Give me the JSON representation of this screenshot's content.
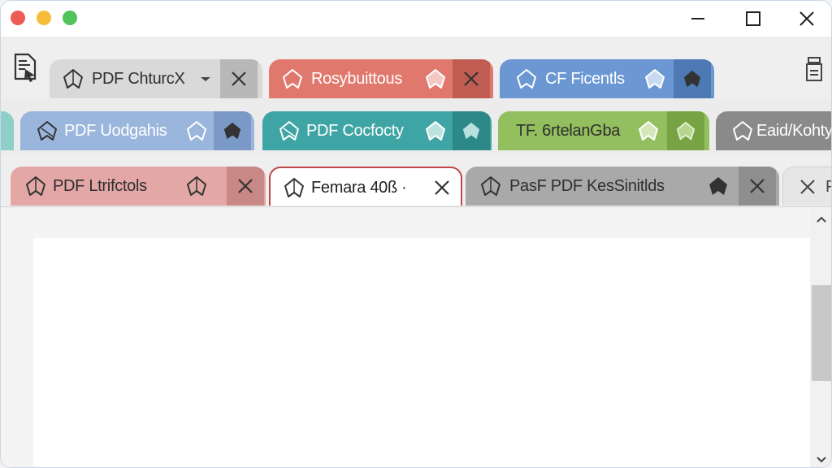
{
  "window": {
    "controls": {
      "minimize_icon": "minimize-icon",
      "maximize_icon": "maximize-icon",
      "close_icon": "close-icon"
    }
  },
  "colors": {
    "gray": "#d6d6d6",
    "red": "#e0776d",
    "blue": "#6d9ad4",
    "lightblue": "#9bb5db",
    "teal": "#3fa6a6",
    "green": "#95bf5f",
    "darkgray": "#888888",
    "pink": "#e3a6a5",
    "midgray": "#a9a9a9",
    "white": "#ffffff"
  },
  "tabs": {
    "row1": [
      {
        "label": "PDF ChturcX",
        "action": "close"
      },
      {
        "label": "Rosybuittous",
        "action": "close"
      },
      {
        "label": "CF Ficentls",
        "action": "pin"
      }
    ],
    "row2": [
      {
        "label": "PDF Uodgahis",
        "action": "pin"
      },
      {
        "label": "PDF Cocfocty",
        "action": "pin"
      },
      {
        "label": "TF. 6rtelanGba",
        "action": "pin"
      },
      {
        "label": "Eaid/Kohty",
        "action": "none"
      }
    ],
    "row3": [
      {
        "label": "PDF Ltrifctols",
        "action": "close"
      },
      {
        "label": "Femara 40ß ·",
        "action": "close",
        "active": true
      },
      {
        "label": "PasF PDF KesSinitlds",
        "action": "close"
      },
      {
        "label": "P",
        "action": "close"
      }
    ]
  }
}
